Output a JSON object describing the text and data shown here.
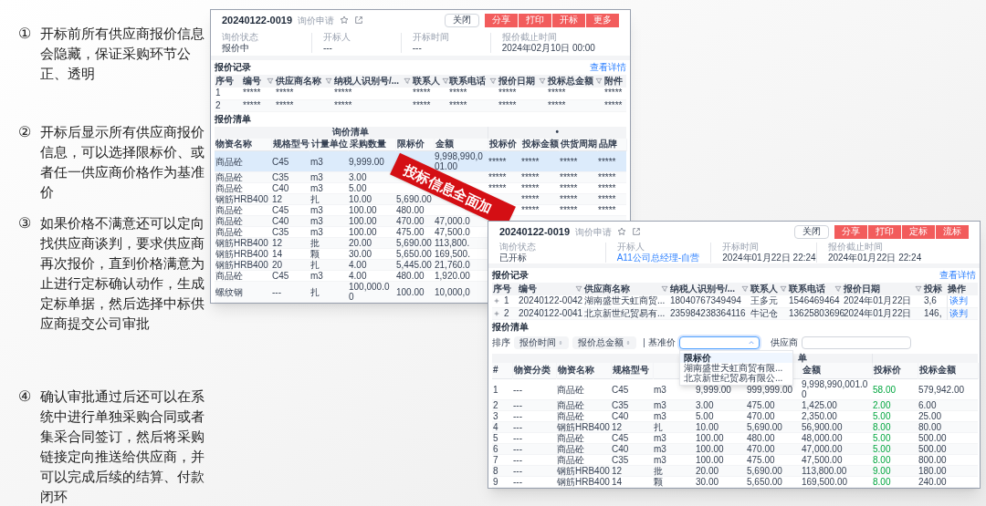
{
  "notes": [
    {
      "marker": "①",
      "text": "开标前所有供应商报价信息会隐藏，保证采购环节公正、透明"
    },
    {
      "marker": "②",
      "text": "开标后显示所有供应商报价信息，可以选择限标价、或者任一供应商价格作为基准价"
    },
    {
      "marker": "③",
      "text": "如果价格不满意还可以定向找供应商谈判，要求供应商再次报价，直到价格满意为止进行定标确认动作，生成定标单据，然后选择中标供应商提交公司审批"
    },
    {
      "marker": "④",
      "text": "确认审批通过后还可以在系统中进行单独采购合同或者集采合同签订，然后将采购链接定向推送给供应商，并可以完成后续的结算、付款闭环"
    }
  ],
  "top_window": {
    "header": {
      "title": "20240122-0019",
      "tag": "询价申请"
    },
    "buttons": [
      {
        "label": "关闭",
        "kind": "default"
      },
      {
        "label": "分享",
        "kind": "primary"
      },
      {
        "label": "打印",
        "kind": "primary"
      },
      {
        "label": "开标",
        "kind": "primary"
      },
      {
        "label": "更多",
        "kind": "primary"
      }
    ],
    "info": [
      {
        "label": "询价状态",
        "value": "报价中",
        "kind": "text"
      },
      {
        "label": "开标人",
        "value": "---",
        "kind": "text"
      },
      {
        "label": "开标时间",
        "value": "---",
        "kind": "text"
      },
      {
        "label": "报价截止时间",
        "value": "2024年02月10日 00:00",
        "kind": "text"
      }
    ],
    "records": {
      "title": "报价记录",
      "link": "查看详情",
      "columns": [
        {
          "label": "序号",
          "filter": false
        },
        {
          "label": "编号",
          "filter": true
        },
        {
          "label": "供应商名称",
          "filter": true
        },
        {
          "label": "纳税人识别号/...",
          "filter": true
        },
        {
          "label": "联系人",
          "filter": true
        },
        {
          "label": "联系电话",
          "filter": true
        },
        {
          "label": "报价日期",
          "filter": true
        },
        {
          "label": "投标总金额",
          "filter": true
        },
        {
          "label": "附件",
          "filter": false
        }
      ],
      "rows": [
        {
          "expandable": false,
          "cells": [
            "1",
            "*****",
            "*****",
            "*****",
            "*****",
            "*****",
            "*****",
            "*****",
            "*****"
          ]
        },
        {
          "expandable": false,
          "cells": [
            "2",
            "*****",
            "*****",
            "*****",
            "*****",
            "*****",
            "*****",
            "*****",
            "*****"
          ]
        }
      ]
    },
    "list": {
      "title": "报价清单",
      "groups": [
        {
          "label": "询价清单",
          "columns": [
            {
              "label": "物资名称",
              "kind": "plain"
            },
            {
              "label": "规格型号",
              "kind": "plain"
            },
            {
              "label": "计量单位",
              "kind": "plain"
            },
            {
              "label": "采购数量",
              "kind": "plain"
            },
            {
              "label": "限标价",
              "kind": "plain"
            },
            {
              "label": "金额",
              "kind": "plain"
            }
          ]
        },
        {
          "label": "•",
          "columns": [
            {
              "label": "投标价",
              "kind": "plain"
            },
            {
              "label": "投标金额",
              "kind": "plain"
            },
            {
              "label": "供货周期",
              "kind": "plain"
            },
            {
              "label": "品牌",
              "kind": "plain"
            }
          ]
        }
      ],
      "rows": [
        {
          "selected": true,
          "cells": [
            "商品砼",
            "C45",
            "m3",
            "9,999.00",
            null,
            "9,998,990,001.00",
            "*****",
            "*****",
            "*****",
            "*****"
          ]
        },
        {
          "selected": false,
          "cells": [
            "商品砼",
            "C35",
            "m3",
            "3.00",
            null,
            null,
            "*****",
            "*****",
            "*****",
            "*****"
          ]
        },
        {
          "selected": false,
          "cells": [
            "商品砼",
            "C40",
            "m3",
            "5.00",
            null,
            null,
            "*****",
            "*****",
            "*****",
            "*****"
          ]
        },
        {
          "selected": false,
          "cells": [
            "钢筋HRB400",
            "12",
            "扎",
            "10.00",
            "5,690.00",
            null,
            null,
            "*****",
            "*****",
            "*****"
          ]
        },
        {
          "selected": false,
          "cells": [
            "商品砼",
            "C45",
            "m3",
            "100.00",
            "480.00",
            null,
            null,
            "*****",
            "*****",
            "*****"
          ]
        },
        {
          "selected": false,
          "cells": [
            "商品砼",
            "C40",
            "m3",
            "100.00",
            "470.00",
            "47,000.0",
            null,
            null,
            null,
            null
          ]
        },
        {
          "selected": false,
          "cells": [
            "商品砼",
            "C35",
            "m3",
            "100.00",
            "475.00",
            "47,500.0",
            null,
            null,
            null,
            null
          ]
        },
        {
          "selected": false,
          "cells": [
            "钢筋HRB400",
            "12",
            "批",
            "20.00",
            "5,690.00",
            "113,800.",
            null,
            null,
            null,
            null
          ]
        },
        {
          "selected": false,
          "cells": [
            "钢筋HRB400",
            "14",
            "颗",
            "30.00",
            "5,650.00",
            "169,500.",
            null,
            null,
            null,
            null
          ]
        },
        {
          "selected": false,
          "cells": [
            "钢筋HRB400",
            "20",
            "扎",
            "4.00",
            "5,445.00",
            "21,760.0",
            null,
            null,
            null,
            null
          ]
        },
        {
          "selected": false,
          "cells": [
            "商品砼",
            "C45",
            "m3",
            "4.00",
            "480.00",
            "1,920.00",
            null,
            null,
            null,
            null
          ]
        },
        {
          "selected": false,
          "cells": [
            "螺纹钢",
            "---",
            "扎",
            "100,000.00",
            "100.00",
            "10,000,0",
            null,
            null,
            null,
            null
          ]
        }
      ]
    }
  },
  "banner": {
    "text": "投标信息全面加"
  },
  "bottom_window": {
    "header": {
      "title": "20240122-0019",
      "tag": "询价申请"
    },
    "buttons": [
      {
        "label": "关闭",
        "kind": "default"
      },
      {
        "label": "分享",
        "kind": "primary"
      },
      {
        "label": "打印",
        "kind": "primary"
      },
      {
        "label": "定标",
        "kind": "primary"
      },
      {
        "label": "流标",
        "kind": "primary"
      }
    ],
    "info": [
      {
        "label": "询价状态",
        "value": "已开标",
        "kind": "text"
      },
      {
        "label": "开标人",
        "value": "A11公司总经理-自营",
        "kind": "link"
      },
      {
        "label": "开标时间",
        "value": "2024年01月22日 22:24",
        "kind": "text"
      },
      {
        "label": "报价截止时间",
        "value": "2024年01月22日 22:24",
        "kind": "text"
      }
    ],
    "records": {
      "title": "报价记录",
      "link": "查看详情",
      "columns": [
        {
          "label": "序号",
          "filter": false
        },
        {
          "label": "编号",
          "filter": true
        },
        {
          "label": "供应商名称",
          "filter": true
        },
        {
          "label": "纳税人识别号/...",
          "filter": true
        },
        {
          "label": "联系人",
          "filter": true
        },
        {
          "label": "联系电话",
          "filter": true
        },
        {
          "label": "报价日期",
          "filter": true
        },
        {
          "label": "投标",
          "filter": false
        },
        {
          "label": "操作",
          "filter": false
        }
      ],
      "rows": [
        {
          "expandable": true,
          "cells": [
            "1",
            "20240122-0042",
            "湖南盛世天虹商贸...",
            "18040767349494",
            "王多元",
            "1546469464",
            "2024年01月22日",
            "3,6"
          ],
          "action": "谈判"
        },
        {
          "expandable": true,
          "cells": [
            "2",
            "20240122-0041",
            "北京新世纪贸易有...",
            "235984238364116",
            "牛记仓",
            "13625803696",
            "2024年01月22日",
            "146,"
          ],
          "action": "谈判"
        }
      ]
    },
    "list": {
      "title": "报价清单",
      "sort": {
        "label": "排序",
        "buttons": [
          "报价时间",
          "报价总金额"
        ],
        "base_price": {
          "label": "基准价",
          "expanded": true,
          "options": [
            {
              "label": "限标价",
              "selected": true
            },
            {
              "label": "湖南盛世天虹商贸有限...",
              "selected": false
            },
            {
              "label": "北京新世纪贸易有限公...",
              "selected": false
            }
          ]
        },
        "supplier_filter": {
          "label": "供应商"
        }
      },
      "groups": [
        {
          "label": "单",
          "columns": [
            {
              "label": "#",
              "kind": "plain"
            },
            {
              "label": "物资分类",
              "kind": "plain"
            },
            {
              "label": "物资名称",
              "kind": "plain"
            },
            {
              "label": "规格型号",
              "kind": "plain"
            },
            {
              "kind": "plain"
            },
            {
              "kind": "plain"
            },
            {
              "kind": "plain"
            },
            {
              "label": "金额",
              "kind": "plain"
            }
          ]
        },
        {
          "columns": [
            {
              "label": "投标价",
              "kind": "bid"
            },
            {
              "label": "投标金额",
              "kind": "plain"
            }
          ]
        }
      ],
      "rows": [
        {
          "cells": [
            "1",
            "---",
            "商品砼",
            "C45",
            "m3",
            "9,999.00",
            "999,999.00",
            "9,998,990,001.00",
            "58.00",
            "579,942.00"
          ]
        },
        {
          "cells": [
            "2",
            "---",
            "商品砼",
            "C35",
            "m3",
            "3.00",
            "475.00",
            "1,425.00",
            "2.00",
            "6.00"
          ]
        },
        {
          "cells": [
            "3",
            "---",
            "商品砼",
            "C40",
            "m3",
            "5.00",
            "470.00",
            "2,350.00",
            "5.00",
            "25.00"
          ]
        },
        {
          "cells": [
            "4",
            "---",
            "钢筋HRB400",
            "12",
            "扎",
            "10.00",
            "5,690.00",
            "56,900.00",
            "8.00",
            "80.00"
          ]
        },
        {
          "cells": [
            "5",
            "---",
            "商品砼",
            "C45",
            "m3",
            "100.00",
            "480.00",
            "48,000.00",
            "5.00",
            "500.00"
          ]
        },
        {
          "cells": [
            "6",
            "---",
            "商品砼",
            "C40",
            "m3",
            "100.00",
            "470.00",
            "47,000.00",
            "5.00",
            "500.00"
          ]
        },
        {
          "cells": [
            "7",
            "---",
            "商品砼",
            "C35",
            "m3",
            "100.00",
            "475.00",
            "47,500.00",
            "8.00",
            "800.00"
          ]
        },
        {
          "cells": [
            "8",
            "---",
            "钢筋HRB400",
            "12",
            "批",
            "20.00",
            "5,690.00",
            "113,800.00",
            "9.00",
            "180.00"
          ]
        },
        {
          "cells": [
            "9",
            "---",
            "钢筋HRB400",
            "14",
            "颗",
            "30.00",
            "5,650.00",
            "169,500.00",
            "8.00",
            "240.00"
          ]
        }
      ]
    }
  }
}
